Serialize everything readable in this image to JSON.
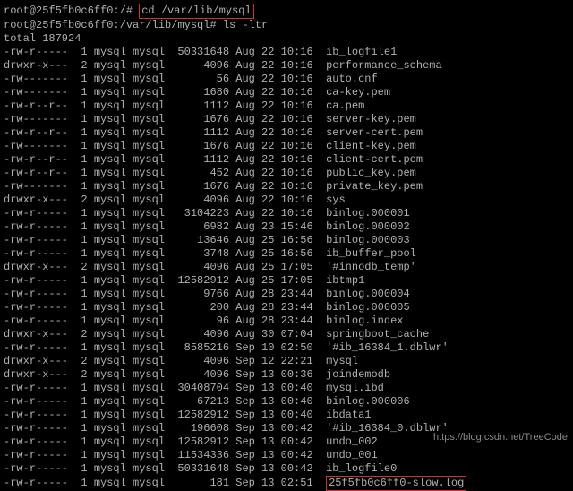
{
  "prompt1_user": "root@25f5fb0c6ff0:/",
  "prompt1_symbol": "#",
  "cmd1": "cd /var/lib/mysql",
  "prompt2_user": "root@25f5fb0c6ff0:/var/lib/mysql",
  "prompt2_symbol": "#",
  "cmd2": "ls -ltr",
  "total_line": "total 187924",
  "rows": [
    {
      "perm": "-rw-r-----",
      "links": "1",
      "owner": "mysql",
      "group": "mysql",
      "size": "50331648",
      "date": "Aug 22 10:16",
      "name": "ib_logfile1"
    },
    {
      "perm": "drwxr-x---",
      "links": "2",
      "owner": "mysql",
      "group": "mysql",
      "size": "4096",
      "date": "Aug 22 10:16",
      "name": "performance_schema"
    },
    {
      "perm": "-rw-------",
      "links": "1",
      "owner": "mysql",
      "group": "mysql",
      "size": "56",
      "date": "Aug 22 10:16",
      "name": "auto.cnf"
    },
    {
      "perm": "-rw-------",
      "links": "1",
      "owner": "mysql",
      "group": "mysql",
      "size": "1680",
      "date": "Aug 22 10:16",
      "name": "ca-key.pem"
    },
    {
      "perm": "-rw-r--r--",
      "links": "1",
      "owner": "mysql",
      "group": "mysql",
      "size": "1112",
      "date": "Aug 22 10:16",
      "name": "ca.pem"
    },
    {
      "perm": "-rw-------",
      "links": "1",
      "owner": "mysql",
      "group": "mysql",
      "size": "1676",
      "date": "Aug 22 10:16",
      "name": "server-key.pem"
    },
    {
      "perm": "-rw-r--r--",
      "links": "1",
      "owner": "mysql",
      "group": "mysql",
      "size": "1112",
      "date": "Aug 22 10:16",
      "name": "server-cert.pem"
    },
    {
      "perm": "-rw-------",
      "links": "1",
      "owner": "mysql",
      "group": "mysql",
      "size": "1676",
      "date": "Aug 22 10:16",
      "name": "client-key.pem"
    },
    {
      "perm": "-rw-r--r--",
      "links": "1",
      "owner": "mysql",
      "group": "mysql",
      "size": "1112",
      "date": "Aug 22 10:16",
      "name": "client-cert.pem"
    },
    {
      "perm": "-rw-r--r--",
      "links": "1",
      "owner": "mysql",
      "group": "mysql",
      "size": "452",
      "date": "Aug 22 10:16",
      "name": "public_key.pem"
    },
    {
      "perm": "-rw-------",
      "links": "1",
      "owner": "mysql",
      "group": "mysql",
      "size": "1676",
      "date": "Aug 22 10:16",
      "name": "private_key.pem"
    },
    {
      "perm": "drwxr-x---",
      "links": "2",
      "owner": "mysql",
      "group": "mysql",
      "size": "4096",
      "date": "Aug 22 10:16",
      "name": "sys"
    },
    {
      "perm": "-rw-r-----",
      "links": "1",
      "owner": "mysql",
      "group": "mysql",
      "size": "3104223",
      "date": "Aug 22 10:16",
      "name": "binlog.000001"
    },
    {
      "perm": "-rw-r-----",
      "links": "1",
      "owner": "mysql",
      "group": "mysql",
      "size": "6982",
      "date": "Aug 23 15:46",
      "name": "binlog.000002"
    },
    {
      "perm": "-rw-r-----",
      "links": "1",
      "owner": "mysql",
      "group": "mysql",
      "size": "13646",
      "date": "Aug 25 16:56",
      "name": "binlog.000003"
    },
    {
      "perm": "-rw-r-----",
      "links": "1",
      "owner": "mysql",
      "group": "mysql",
      "size": "3748",
      "date": "Aug 25 16:56",
      "name": "ib_buffer_pool"
    },
    {
      "perm": "drwxr-x---",
      "links": "2",
      "owner": "mysql",
      "group": "mysql",
      "size": "4096",
      "date": "Aug 25 17:05",
      "name": "'#innodb_temp'"
    },
    {
      "perm": "-rw-r-----",
      "links": "1",
      "owner": "mysql",
      "group": "mysql",
      "size": "12582912",
      "date": "Aug 25 17:05",
      "name": "ibtmp1"
    },
    {
      "perm": "-rw-r-----",
      "links": "1",
      "owner": "mysql",
      "group": "mysql",
      "size": "9766",
      "date": "Aug 28 23:44",
      "name": "binlog.000004"
    },
    {
      "perm": "-rw-r-----",
      "links": "1",
      "owner": "mysql",
      "group": "mysql",
      "size": "200",
      "date": "Aug 28 23:44",
      "name": "binlog.000005"
    },
    {
      "perm": "-rw-r-----",
      "links": "1",
      "owner": "mysql",
      "group": "mysql",
      "size": "96",
      "date": "Aug 28 23:44",
      "name": "binlog.index"
    },
    {
      "perm": "drwxr-x---",
      "links": "2",
      "owner": "mysql",
      "group": "mysql",
      "size": "4096",
      "date": "Aug 30 07:04",
      "name": "springboot_cache"
    },
    {
      "perm": "-rw-r-----",
      "links": "1",
      "owner": "mysql",
      "group": "mysql",
      "size": "8585216",
      "date": "Sep 10 02:50",
      "name": "'#ib_16384_1.dblwr'"
    },
    {
      "perm": "drwxr-x---",
      "links": "2",
      "owner": "mysql",
      "group": "mysql",
      "size": "4096",
      "date": "Sep 12 22:21",
      "name": "mysql"
    },
    {
      "perm": "drwxr-x---",
      "links": "2",
      "owner": "mysql",
      "group": "mysql",
      "size": "4096",
      "date": "Sep 13 00:36",
      "name": "joindemodb"
    },
    {
      "perm": "-rw-r-----",
      "links": "1",
      "owner": "mysql",
      "group": "mysql",
      "size": "30408704",
      "date": "Sep 13 00:40",
      "name": "mysql.ibd"
    },
    {
      "perm": "-rw-r-----",
      "links": "1",
      "owner": "mysql",
      "group": "mysql",
      "size": "67213",
      "date": "Sep 13 00:40",
      "name": "binlog.000006"
    },
    {
      "perm": "-rw-r-----",
      "links": "1",
      "owner": "mysql",
      "group": "mysql",
      "size": "12582912",
      "date": "Sep 13 00:40",
      "name": "ibdata1"
    },
    {
      "perm": "-rw-r-----",
      "links": "1",
      "owner": "mysql",
      "group": "mysql",
      "size": "196608",
      "date": "Sep 13 00:42",
      "name": "'#ib_16384_0.dblwr'"
    },
    {
      "perm": "-rw-r-----",
      "links": "1",
      "owner": "mysql",
      "group": "mysql",
      "size": "12582912",
      "date": "Sep 13 00:42",
      "name": "undo_002"
    },
    {
      "perm": "-rw-r-----",
      "links": "1",
      "owner": "mysql",
      "group": "mysql",
      "size": "11534336",
      "date": "Sep 13 00:42",
      "name": "undo_001"
    },
    {
      "perm": "-rw-r-----",
      "links": "1",
      "owner": "mysql",
      "group": "mysql",
      "size": "50331648",
      "date": "Sep 13 00:42",
      "name": "ib_logfile0"
    },
    {
      "perm": "-rw-r-----",
      "links": "1",
      "owner": "mysql",
      "group": "mysql",
      "size": "181",
      "date": "Sep 13 02:51",
      "name": "25f5fb0c6ff0-slow.log"
    }
  ],
  "highlight_last": true,
  "watermark": "https://blog.csdn.net/TreeCode"
}
